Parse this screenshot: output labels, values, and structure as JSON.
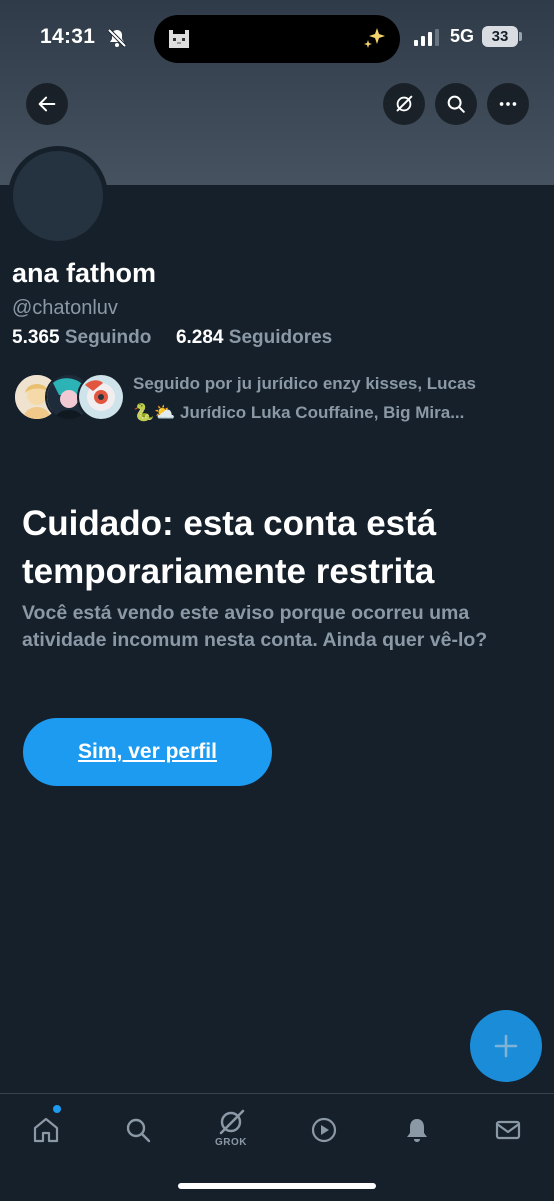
{
  "status_bar": {
    "time": "14:31",
    "network": "5G",
    "battery": "33"
  },
  "profile": {
    "name": "ana fathom",
    "handle": "@chatonluv",
    "following_count": "5.365",
    "following_label": "Seguindo",
    "followers_count": "6.284",
    "followers_label": "Seguidores",
    "followed_by_line1": "Seguido por ju jurídico enzy kisses, Lucas",
    "followed_by_line2": "🐍⛅ Jurídico Luka Couffaine, Big Mira..."
  },
  "warning": {
    "title": "Cuidado: esta conta está temporariamente restrita",
    "body": "Você está vendo este aviso porque ocorreu uma atividade incomum nesta conta. Ainda quer vê-lo?",
    "button_label": "Sim, ver perfil"
  },
  "tab_bar": {
    "grok_label": "GROK"
  },
  "colors": {
    "background": "#15202b",
    "accent": "#1d9bf0",
    "secondary_text": "#8b98a5"
  }
}
